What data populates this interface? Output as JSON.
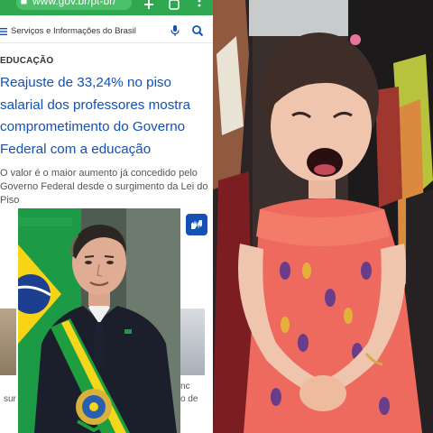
{
  "browser": {
    "url": "www.gov.br/pt-br/"
  },
  "site_header": {
    "search_label": "Serviços e Informações do Brasil"
  },
  "article": {
    "category": "EDUCAÇÃO",
    "headline": "Reajuste de 33,24% no piso salarial dos professores mostra comprometimento do Governo Federal com a educação",
    "subtitle": "O valor é o maior aumento já concedido pelo Governo Federal desde o surgimento da Lei do Piso"
  },
  "related": {
    "left_fragment": "sur",
    "right_fragment_1": "nc",
    "right_fragment_2": "o de"
  },
  "colors": {
    "gov_green": "#2fa84f",
    "gov_blue": "#1351b4",
    "sash_green": "#1e9e3e",
    "sash_yellow": "#f4d61c",
    "dress": "#ef6a5e"
  }
}
